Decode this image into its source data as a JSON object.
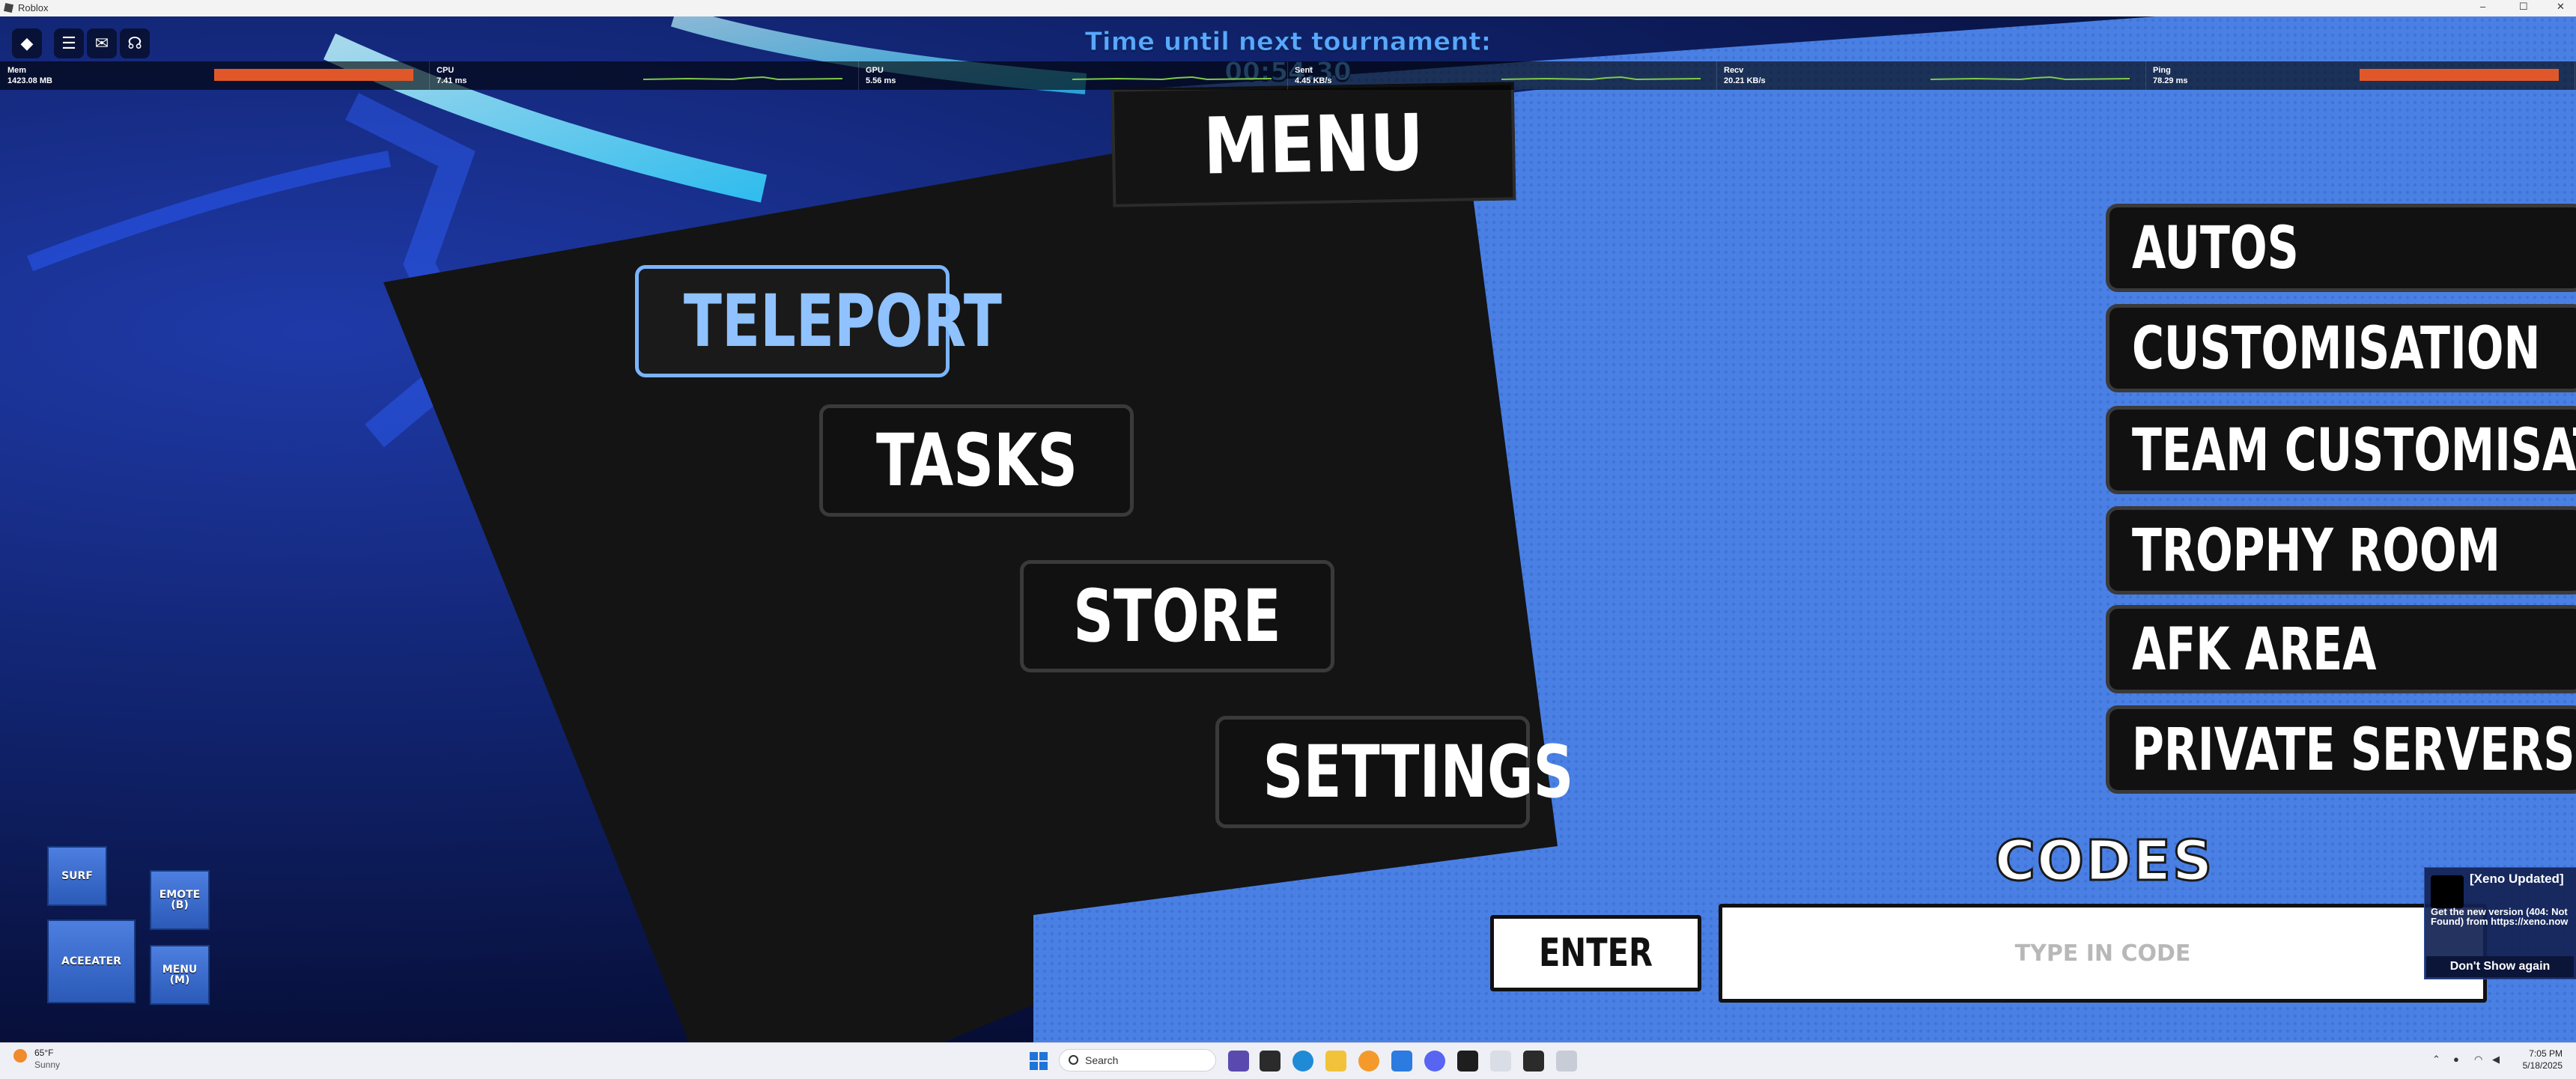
{
  "window": {
    "title": "Roblox",
    "controls": {
      "minimize": "–",
      "maximize": "☐",
      "close": "✕"
    }
  },
  "topbar": {
    "icons": [
      "roblox-logo-icon",
      "hamburger-menu-icon",
      "chat-icon",
      "headset-icon"
    ],
    "tournament_text": "Time until next tournament: 00:54:30"
  },
  "stats": [
    {
      "name": "Mem",
      "value": "1423.08 MB",
      "color": "#e0582a"
    },
    {
      "name": "CPU",
      "value": "7.41 ms",
      "color": "#7ec94a"
    },
    {
      "name": "GPU",
      "value": "5.56 ms",
      "color": "#7ec94a"
    },
    {
      "name": "Sent",
      "value": "4.45 KB/s",
      "color": "#7ec94a"
    },
    {
      "name": "Recv",
      "value": "20.21 KB/s",
      "color": "#7ec94a"
    },
    {
      "name": "Ping",
      "value": "78.29 ms",
      "color": "#e0582a"
    }
  ],
  "menu": {
    "title": "MENU",
    "left_buttons": [
      "TELEPORT",
      "TASKS",
      "STORE",
      "SETTINGS"
    ],
    "right_buttons": [
      "AUTOS",
      "CUSTOMISATION",
      "TEAM CUSTOMISATION",
      "TROPHY ROOM",
      "AFK AREA",
      "PRIVATE SERVERS"
    ]
  },
  "codes": {
    "title": "CODES",
    "enter_label": "ENTER",
    "input_placeholder": "TYPE IN CODE",
    "input_value": ""
  },
  "keybinds": {
    "surf": "SURF",
    "emote_line1": "EMOTE",
    "emote_line2": "(B)",
    "aceeater": "ACEEATER",
    "menu_line1": "MENU",
    "menu_line2": "(M)"
  },
  "notification": {
    "title": "[Xeno Updated]",
    "message": "Get the new version (404: Not Found) from https://xeno.now",
    "button": "Don't Show again"
  },
  "taskbar": {
    "weather_temp": "65°F",
    "weather_desc": "Sunny",
    "weather_badge": "1",
    "search_placeholder": "Search",
    "time": "7:05 PM",
    "date": "5/18/2025"
  },
  "colors": {
    "accent_blue": "#4b82e6",
    "selected_text": "#8fc2ff",
    "button_bg": "#111111"
  }
}
